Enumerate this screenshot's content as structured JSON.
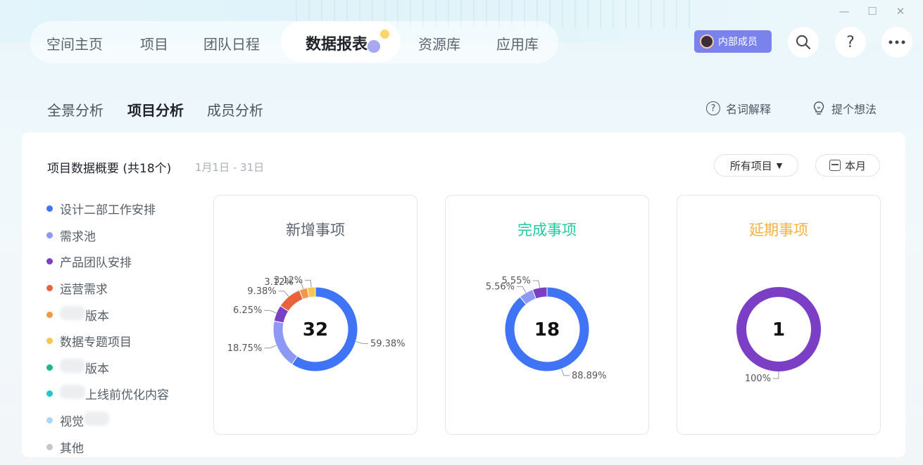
{
  "window": {
    "minimize": "—",
    "maximize": "☐",
    "close": "✕"
  },
  "nav": {
    "tabs": [
      "空间主页",
      "项目",
      "团队日程",
      "资源库",
      "应用库"
    ],
    "active": "数据报表",
    "member_badge": "内部成员",
    "icons": [
      "search-icon",
      "help-icon",
      "more-icon"
    ]
  },
  "subtabs": {
    "overview": "全景分析",
    "project": "项目分析",
    "member": "成员分析"
  },
  "links": {
    "glossary": "名词解释",
    "idea": "提个想法"
  },
  "overview": {
    "title": "项目数据概要 (共18个)",
    "date_range": "1月1日 - 31日",
    "filter_label": "所有项目",
    "period_label": "本月"
  },
  "legend": [
    {
      "label": "设计二部工作安排",
      "color": "#3e74f5",
      "blurred_prefix": false
    },
    {
      "label": "需求池",
      "color": "#8e98f5",
      "blurred_prefix": false
    },
    {
      "label": "产品团队安排",
      "color": "#7b3fc6",
      "blurred_prefix": false
    },
    {
      "label": "运营需求",
      "color": "#e8623e",
      "blurred_prefix": false
    },
    {
      "label": "版本",
      "color": "#f1994a",
      "blurred_prefix": true
    },
    {
      "label": "数据专题项目",
      "color": "#f6c74a",
      "blurred_prefix": false
    },
    {
      "label": "版本",
      "color": "#18b989",
      "blurred_prefix": true
    },
    {
      "label": "上线前优化内容",
      "color": "#20c9c9",
      "blurred_prefix": true
    },
    {
      "label": "视觉",
      "color": "#a7d8f5",
      "blurred_suffix": true
    },
    {
      "label": "其他",
      "color": "#c4c6c9",
      "blurred_prefix": false
    }
  ],
  "cards": [
    {
      "title": "新增事项",
      "title_color": "#5c6470",
      "total": "32",
      "segments": [
        {
          "value": 59.38,
          "label": "59.38%",
          "color": "#3e74f5"
        },
        {
          "value": 18.75,
          "label": "18.75%",
          "color": "#8e98f5"
        },
        {
          "value": 6.25,
          "label": "6.25%",
          "color": "#7b3fc6"
        },
        {
          "value": 9.38,
          "label": "9.38%",
          "color": "#e8623e"
        },
        {
          "value": 3.12,
          "label": "3.12%",
          "color": "#f1994a"
        },
        {
          "value": 3.12,
          "label": "3.12%",
          "color": "#f6c74a"
        }
      ]
    },
    {
      "title": "完成事项",
      "title_color": "#20c9a0",
      "total": "18",
      "segments": [
        {
          "value": 88.89,
          "label": "88.89%",
          "color": "#3e74f5"
        },
        {
          "value": 5.56,
          "label": "5.56%",
          "color": "#8e98f5"
        },
        {
          "value": 5.55,
          "label": "5.55%",
          "color": "#7b3fc6"
        }
      ]
    },
    {
      "title": "延期事项",
      "title_color": "#f5b041",
      "total": "1",
      "segments": [
        {
          "value": 100,
          "label": "100%",
          "color": "#7b3fc6"
        }
      ]
    }
  ]
}
